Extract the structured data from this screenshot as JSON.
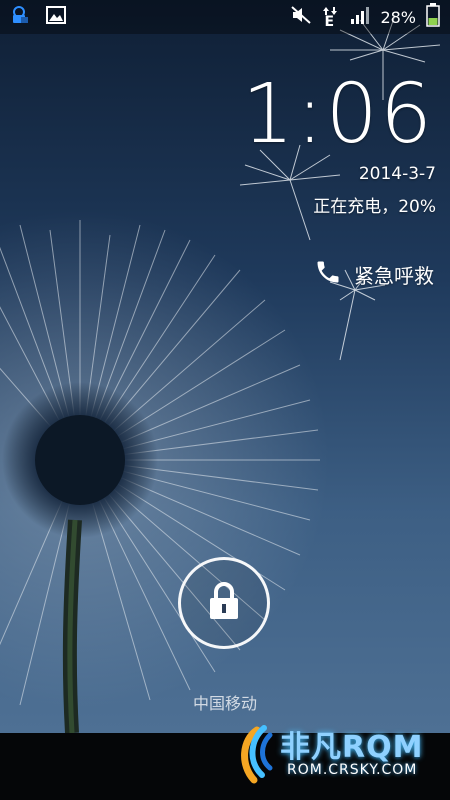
{
  "status_bar": {
    "battery_percent": "28%",
    "network_type": "E",
    "icons": [
      "lock-network-icon",
      "image-notification-icon",
      "mute-icon",
      "data-arrows-icon",
      "signal-icon",
      "battery-icon"
    ],
    "battery_color": "#8fd14f"
  },
  "lockscreen": {
    "time": "1:06",
    "date": "2014-3-7",
    "charging_status": "正在充电，20%",
    "emergency_call_label": "紧急呼救",
    "carrier": "中国移动"
  },
  "watermark": {
    "brand": "非凡RQM",
    "url": "ROM.CRSKY.COM"
  }
}
